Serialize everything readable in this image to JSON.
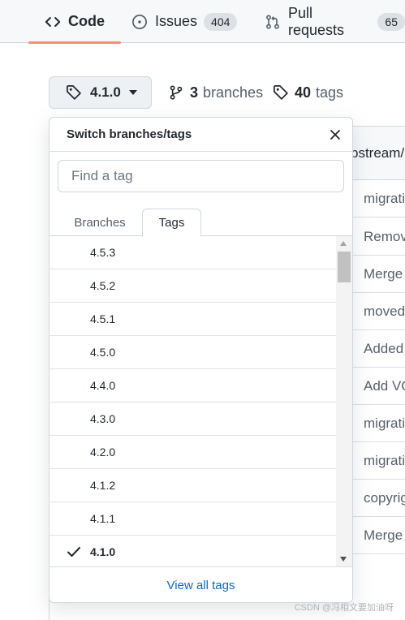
{
  "nav": {
    "tabs": [
      {
        "label": "Code",
        "icon": "code-icon"
      },
      {
        "label": "Issues",
        "count": "404",
        "icon": "issue-opened-icon"
      },
      {
        "label": "Pull requests",
        "count": "65",
        "icon": "git-pull-request-icon"
      }
    ],
    "active_color": "#fd8c73"
  },
  "selector": {
    "current_ref": "4.1.0",
    "branches_count": "3",
    "branches_label": "branches",
    "tags_count": "40",
    "tags_label": "tags"
  },
  "file_list": {
    "header": "pstream/",
    "rows": [
      "migrati",
      "Remov",
      "Merge",
      "moved",
      "Added",
      "Add VC",
      "migrati",
      "migrati",
      "copyrig",
      "Merge"
    ]
  },
  "dropdown": {
    "title": "Switch branches/tags",
    "search_placeholder": "Find a tag",
    "tabs": [
      "Branches",
      "Tags"
    ],
    "active_tab": "Tags",
    "tags": [
      "4.5.3",
      "4.5.2",
      "4.5.1",
      "4.5.0",
      "4.4.0",
      "4.3.0",
      "4.2.0",
      "4.1.2",
      "4.1.1",
      "4.1.0"
    ],
    "selected_tag": "4.1.0",
    "footer_link": "View all tags",
    "link_color": "#0969da"
  },
  "watermark": "CSDN @冯相文要加油呀"
}
